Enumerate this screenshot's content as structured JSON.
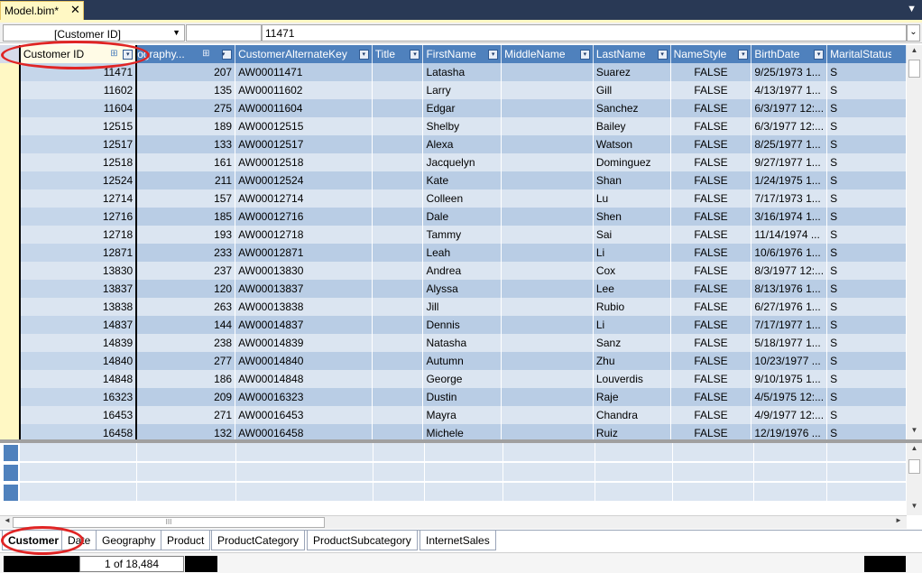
{
  "document_tab": {
    "title": "Model.bim*",
    "close_glyph": "✕",
    "dropdown_glyph": "▼"
  },
  "formula_bar": {
    "column_selector": "[Customer ID]",
    "formula_value": "11471",
    "dropdown_glyph": "▼",
    "expand_glyph": "⌄"
  },
  "grid": {
    "columns": [
      {
        "label": "Customer ID"
      },
      {
        "label": "Geography..."
      },
      {
        "label": "CustomerAlternateKey"
      },
      {
        "label": "Title"
      },
      {
        "label": "FirstName"
      },
      {
        "label": "MiddleName"
      },
      {
        "label": "LastName"
      },
      {
        "label": "NameStyle"
      },
      {
        "label": "BirthDate"
      },
      {
        "label": "MaritalStatus"
      }
    ],
    "filter_glyph": "▾",
    "rows": [
      [
        "11471",
        "207",
        "AW00011471",
        "",
        "Latasha",
        "",
        "Suarez",
        "FALSE",
        "9/25/1973 1...",
        "S"
      ],
      [
        "11602",
        "135",
        "AW00011602",
        "",
        "Larry",
        "",
        "Gill",
        "FALSE",
        "4/13/1977 1...",
        "S"
      ],
      [
        "11604",
        "275",
        "AW00011604",
        "",
        "Edgar",
        "",
        "Sanchez",
        "FALSE",
        "6/3/1977 12:...",
        "S"
      ],
      [
        "12515",
        "189",
        "AW00012515",
        "",
        "Shelby",
        "",
        "Bailey",
        "FALSE",
        "6/3/1977 12:...",
        "S"
      ],
      [
        "12517",
        "133",
        "AW00012517",
        "",
        "Alexa",
        "",
        "Watson",
        "FALSE",
        "8/25/1977 1...",
        "S"
      ],
      [
        "12518",
        "161",
        "AW00012518",
        "",
        "Jacquelyn",
        "",
        "Dominguez",
        "FALSE",
        "9/27/1977 1...",
        "S"
      ],
      [
        "12524",
        "211",
        "AW00012524",
        "",
        "Kate",
        "",
        "Shan",
        "FALSE",
        "1/24/1975 1...",
        "S"
      ],
      [
        "12714",
        "157",
        "AW00012714",
        "",
        "Colleen",
        "",
        "Lu",
        "FALSE",
        "7/17/1973 1...",
        "S"
      ],
      [
        "12716",
        "185",
        "AW00012716",
        "",
        "Dale",
        "",
        "Shen",
        "FALSE",
        "3/16/1974 1...",
        "S"
      ],
      [
        "12718",
        "193",
        "AW00012718",
        "",
        "Tammy",
        "",
        "Sai",
        "FALSE",
        "11/14/1974 ...",
        "S"
      ],
      [
        "12871",
        "233",
        "AW00012871",
        "",
        "Leah",
        "",
        "Li",
        "FALSE",
        "10/6/1976 1...",
        "S"
      ],
      [
        "13830",
        "237",
        "AW00013830",
        "",
        "Andrea",
        "",
        "Cox",
        "FALSE",
        "8/3/1977 12:...",
        "S"
      ],
      [
        "13837",
        "120",
        "AW00013837",
        "",
        "Alyssa",
        "",
        "Lee",
        "FALSE",
        "8/13/1976 1...",
        "S"
      ],
      [
        "13838",
        "263",
        "AW00013838",
        "",
        "Jill",
        "",
        "Rubio",
        "FALSE",
        "6/27/1976 1...",
        "S"
      ],
      [
        "14837",
        "144",
        "AW00014837",
        "",
        "Dennis",
        "",
        "Li",
        "FALSE",
        "7/17/1977 1...",
        "S"
      ],
      [
        "14839",
        "238",
        "AW00014839",
        "",
        "Natasha",
        "",
        "Sanz",
        "FALSE",
        "5/18/1977 1...",
        "S"
      ],
      [
        "14840",
        "277",
        "AW00014840",
        "",
        "Autumn",
        "",
        "Zhu",
        "FALSE",
        "10/23/1977 ...",
        "S"
      ],
      [
        "14848",
        "186",
        "AW00014848",
        "",
        "George",
        "",
        "Louverdis",
        "FALSE",
        "9/10/1975 1...",
        "S"
      ],
      [
        "16323",
        "209",
        "AW00016323",
        "",
        "Dustin",
        "",
        "Raje",
        "FALSE",
        "4/5/1975 12:...",
        "S"
      ],
      [
        "16453",
        "271",
        "AW00016453",
        "",
        "Mayra",
        "",
        "Chandra",
        "FALSE",
        "4/9/1977 12:...",
        "S"
      ],
      [
        "16458",
        "132",
        "AW00016458",
        "",
        "Michele",
        "",
        "Ruiz",
        "FALSE",
        "12/19/1976 ...",
        "S"
      ]
    ]
  },
  "scroll": {
    "up": "▲",
    "down": "▼",
    "left": "◄",
    "right": "►",
    "grip": "III"
  },
  "sheet_tabs": [
    {
      "label": "Customer"
    },
    {
      "label": "Date"
    },
    {
      "label": "Geography"
    },
    {
      "label": "Product"
    },
    {
      "label": "ProductCategory"
    },
    {
      "label": "ProductSubcategory"
    },
    {
      "label": "InternetSales"
    }
  ],
  "status_bar": {
    "record_count": "1 of 18,484"
  },
  "colors": {
    "header_blue": "#4f81bd",
    "row_dark": "#b9cde5",
    "row_light": "#dbe5f1",
    "annotation_red": "#e02424"
  }
}
